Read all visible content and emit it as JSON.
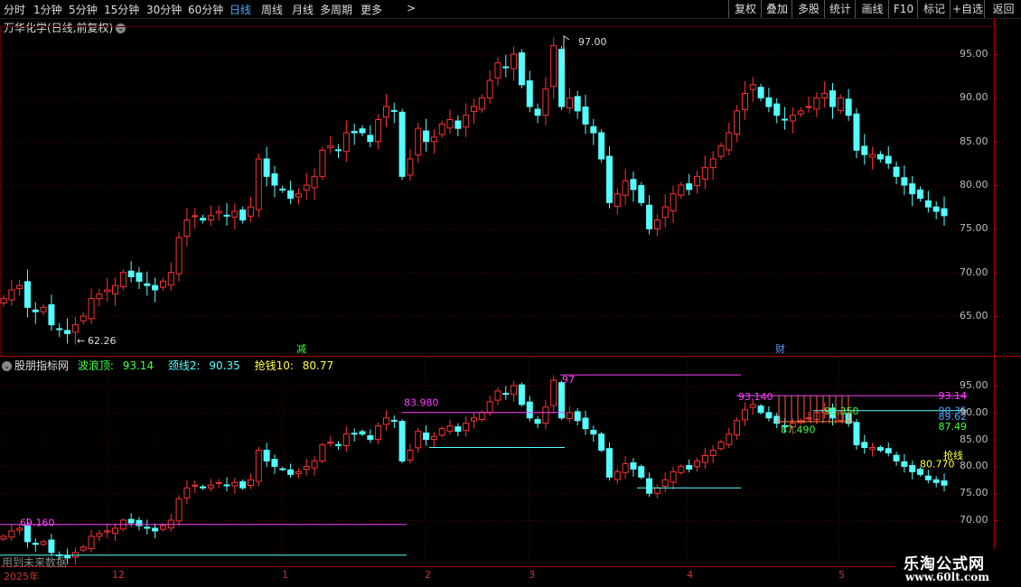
{
  "toolbar": {
    "periods": [
      {
        "label": "分时",
        "active": false
      },
      {
        "label": "1分钟",
        "active": false
      },
      {
        "label": "5分钟",
        "active": false
      },
      {
        "label": "15分钟",
        "active": false
      },
      {
        "label": "30分钟",
        "active": false
      },
      {
        "label": "60分钟",
        "active": false
      },
      {
        "label": "日线",
        "active": true
      },
      {
        "label": "周线",
        "active": false
      },
      {
        "label": "月线",
        "active": false
      },
      {
        "label": "多周期",
        "active": false
      },
      {
        "label": "更多",
        "active": false
      }
    ],
    "more_arrow": ">",
    "buttons": [
      "复权",
      "叠加",
      "多股",
      "统计",
      "画线",
      "F10",
      "标记",
      "+自选",
      "返回"
    ]
  },
  "main": {
    "title": "万华化学(日线,前复权)",
    "high_label": "97.00",
    "low_label": "62.26",
    "low_arrow": "←",
    "event_mark_1": "减",
    "event_mark_2": "财",
    "y_axis": [
      "95.00",
      "90.00",
      "85.00",
      "80.00",
      "75.00",
      "70.00",
      "65.00"
    ]
  },
  "indicator": {
    "name": "股朋指标网",
    "wave_top_label": "波浪顶:",
    "wave_top_value": "93.14",
    "neckline_label": "颈线2:",
    "neckline_value": "90.35",
    "grab_label": "抢钱10:",
    "grab_value": "80.77",
    "y_axis": [
      "95.00",
      "90.00",
      "85.00",
      "80.00",
      "75.00",
      "70.00"
    ],
    "right_labels": [
      "93.14",
      "90.35",
      "89.62",
      "87.49"
    ],
    "annotations": [
      "69.160",
      "83.980",
      "97",
      "93.140",
      "87.490",
      "90.350",
      "80.770",
      "抢线"
    ],
    "future_note": "用到未来数据"
  },
  "dates": [
    "2025年",
    "12",
    "1",
    "2",
    "3",
    "4",
    "5"
  ],
  "watermark": {
    "line1": "乐淘公式网",
    "line2": "www.60lt.com"
  },
  "colors": {
    "up": "#ff3232",
    "down": "#54ffff",
    "grid": "#5a0000",
    "magenta": "#ff40ff",
    "cyan": "#54ffff",
    "yellow": "#ffff40",
    "green": "#40ff40"
  }
}
